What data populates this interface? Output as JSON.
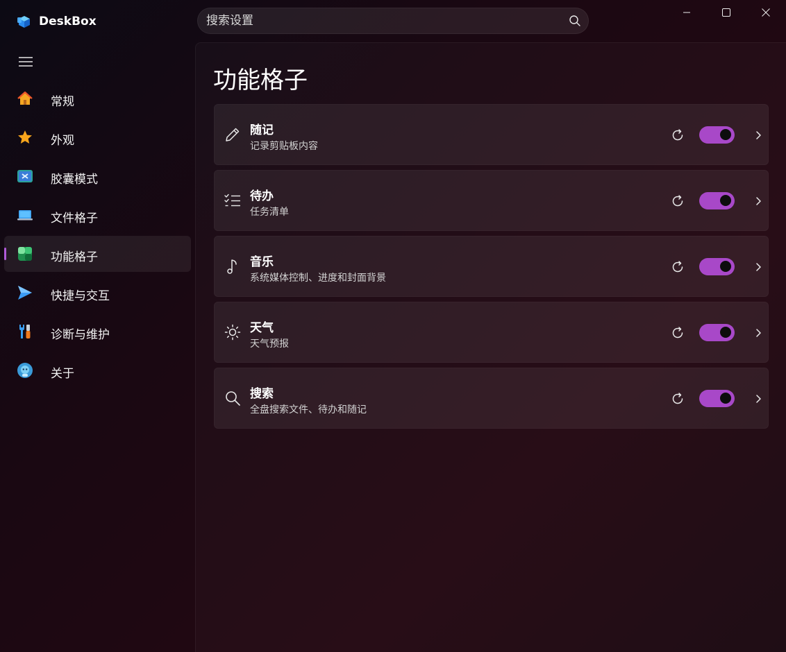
{
  "app": {
    "title": "DeskBox"
  },
  "search": {
    "placeholder": "搜索设置"
  },
  "sidebar": {
    "items": [
      {
        "label": "常规",
        "icon": "home-icon",
        "active": false
      },
      {
        "label": "外观",
        "icon": "star-icon",
        "active": false
      },
      {
        "label": "胶囊模式",
        "icon": "capsule-icon",
        "active": false
      },
      {
        "label": "文件格子",
        "icon": "laptop-icon",
        "active": false
      },
      {
        "label": "功能格子",
        "icon": "grid-icon",
        "active": true
      },
      {
        "label": "快捷与交互",
        "icon": "send-icon",
        "active": false
      },
      {
        "label": "诊断与维护",
        "icon": "tools-icon",
        "active": false
      },
      {
        "label": "关于",
        "icon": "robot-icon",
        "active": false
      }
    ]
  },
  "page": {
    "title": "功能格子"
  },
  "cards": [
    {
      "title": "随记",
      "desc": "记录剪贴板内容",
      "icon": "pencil-icon",
      "enabled": true
    },
    {
      "title": "待办",
      "desc": "任务清单",
      "icon": "checklist-icon",
      "enabled": true
    },
    {
      "title": "音乐",
      "desc": "系统媒体控制、进度和封面背景",
      "icon": "music-note-icon",
      "enabled": true
    },
    {
      "title": "天气",
      "desc": "天气预报",
      "icon": "sun-icon",
      "enabled": true
    },
    {
      "title": "搜索",
      "desc": "全盘搜索文件、待办和随记",
      "icon": "search-icon",
      "enabled": true
    }
  ],
  "colors": {
    "accent": "#a848c8",
    "indicator": "#b05ad8"
  }
}
